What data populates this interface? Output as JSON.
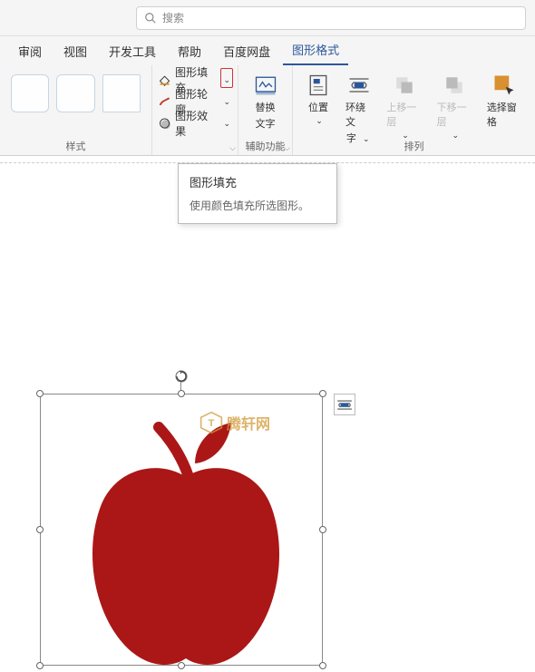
{
  "search": {
    "placeholder": "搜索"
  },
  "tabs": {
    "review": "审阅",
    "view": "视图",
    "dev": "开发工具",
    "help": "帮助",
    "baidu": "百度网盘",
    "shapefmt": "图形格式"
  },
  "ribbon": {
    "styles_label": "样式",
    "fill": {
      "label": "图形填充",
      "outline": "图形轮廓",
      "effects": "图形效果"
    },
    "alttext": {
      "line1": "替换",
      "line2": "文字"
    },
    "alttext_group": "辅助功能",
    "position": "位置",
    "wrap": {
      "line1": "环绕文",
      "line2": "字"
    },
    "forward": "上移一层",
    "backward": "下移一层",
    "selection": "选择窗格",
    "arrange_group": "排列"
  },
  "tooltip": {
    "title": "图形填充",
    "body": "使用颜色填充所选图形。"
  },
  "watermark": {
    "text": "腾轩网"
  }
}
